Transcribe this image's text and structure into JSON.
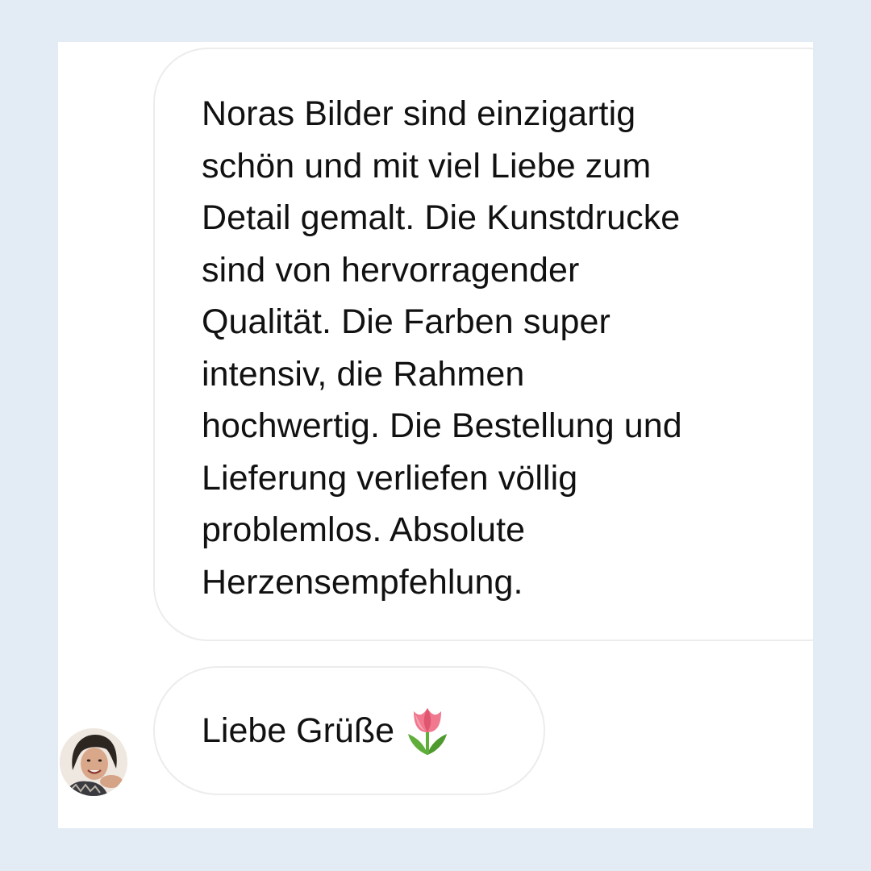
{
  "conversation": {
    "messages": [
      {
        "text": "Noras Bilder sind einzigartig\nschön und mit viel Liebe zum\nDetail gemalt. Die Kunstdrucke\nsind von hervorragender\nQualität. Die Farben super\nintensiv, die Rahmen\nhochwertig. Die Bestellung und\nLieferung verliefen völlig\nproblemlos. Absolute\nHerzensempfehlung."
      },
      {
        "text": "Liebe Grüße",
        "emoji": "tulip-emoji"
      }
    ],
    "sender_avatar": "avatar-photo"
  },
  "colors": {
    "page_background": "#e3ebf4",
    "panel_background": "#ffffff",
    "bubble_border": "#ececec",
    "text": "#111111"
  }
}
